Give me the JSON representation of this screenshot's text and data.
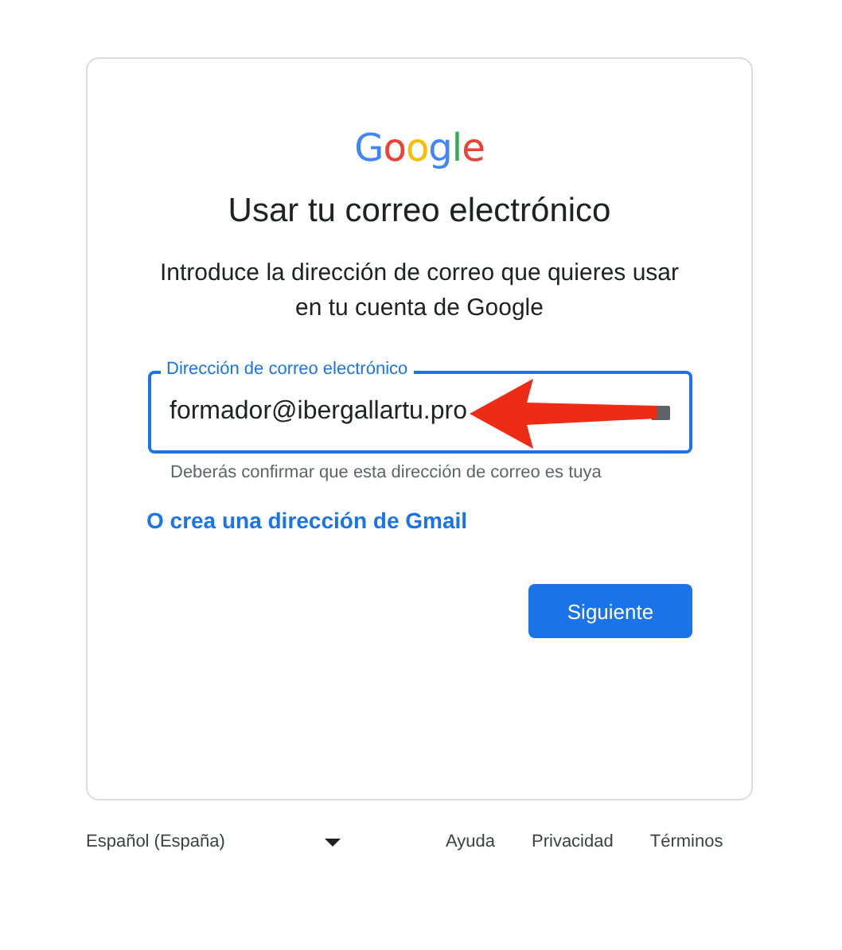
{
  "card": {
    "logo": "Google",
    "title": "Usar tu correo electrónico",
    "subtitle": "Introduce la dirección de correo que quieres usar en tu cuenta de Google",
    "email_field": {
      "label": "Dirección de correo electrónico",
      "value": "formador@ibergallartu.pro",
      "focused": true
    },
    "helper": "Deberás confirmar que esta dirección de correo es tuya",
    "link": "O crea una dirección de Gmail",
    "next_button": "Siguiente"
  },
  "footer": {
    "language": "Español (España)",
    "links": [
      "Ayuda",
      "Privacidad",
      "Términos"
    ]
  }
}
